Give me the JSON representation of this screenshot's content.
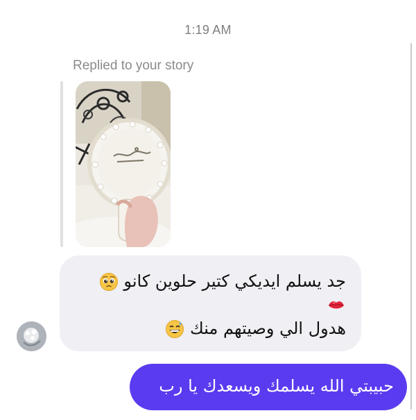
{
  "thread": {
    "timestamp": "1:19 AM",
    "reply_label": "Replied to your story"
  },
  "received_message": {
    "line1": "جد يسلم ايديكي  كتير حلوين كانو",
    "line1_emoji": "pleading-face",
    "line2_emoji": "kiss-mark",
    "line3": "هدول الي وصيتهم منك",
    "line3_emoji": "grinning-face-with-sweat",
    "bubble_color": "#efeff4"
  },
  "sent_message": {
    "text": "حبيبتي الله يسلمك ويسعدك يا رب",
    "bubble_color": "#5b3bf0",
    "text_color": "#ffffff"
  },
  "colors": {
    "timestamp": "#7f7f7f",
    "reply_label": "#8a8a8a"
  }
}
